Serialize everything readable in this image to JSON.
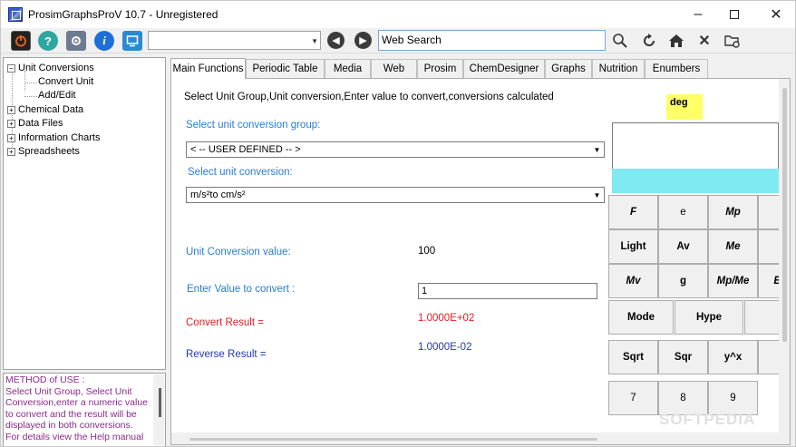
{
  "window": {
    "title": "ProsimGraphsProV 10.7 - Unregistered"
  },
  "toolbar": {
    "combo_value": "",
    "web_search": "Web Search"
  },
  "tree": {
    "items": [
      {
        "label": "Unit Conversions",
        "expander": "−"
      },
      {
        "label": "Convert Unit"
      },
      {
        "label": "Add/Edit"
      },
      {
        "label": "Chemical Data",
        "expander": "+"
      },
      {
        "label": "Data Files",
        "expander": "+"
      },
      {
        "label": "Information Charts",
        "expander": "+"
      },
      {
        "label": "Spreadsheets",
        "expander": "+"
      }
    ]
  },
  "method_of_use": "METHOD of USE :\nSelect Unit Group, Select Unit Conversion,enter a numeric value to convert and the result will be displayed in both conversions.\n For details view the Help manual",
  "tabs": [
    "Main Functions",
    "Periodic Table",
    "Media",
    "Web",
    "Prosim",
    "ChemDesigner",
    "Graphs",
    "Nutrition",
    "Enumbers"
  ],
  "main": {
    "instructions": "Select Unit Group,Unit conversion,Enter value to convert,conversions calculated",
    "group_label": "Select unit conversion group:",
    "group_value": "< -- USER DEFINED -- >",
    "conversion_label": "Select unit conversion:",
    "conversion_value": "m/s²to cm/s²",
    "unit_conversion_label": "Unit Conversion value:",
    "unit_conversion_value": "100",
    "enter_value_label": "Enter Value to convert :",
    "enter_value": "1",
    "convert_result_label": "Convert Result =",
    "convert_result_value": "1.0000E+02",
    "reverse_result_label": "Reverse Result =",
    "reverse_result_value": "1.0000E-02"
  },
  "calculator": {
    "mode_indicator": "deg",
    "buttons": {
      "F": "F",
      "e": "e",
      "Mp": "Mp",
      "Light": "Light",
      "Av": "Av",
      "Me": "Me",
      "Mv": "Mv",
      "g": "g",
      "MpMe": "Mp/Me",
      "E": "E",
      "Mode": "Mode",
      "Hype": "Hype",
      "Sqrt": "Sqrt",
      "Sqr": "Sqr",
      "ypowx": "y^x",
      "7": "7",
      "8": "8",
      "9": "9"
    }
  },
  "watermark": "SOFTPEDIA"
}
